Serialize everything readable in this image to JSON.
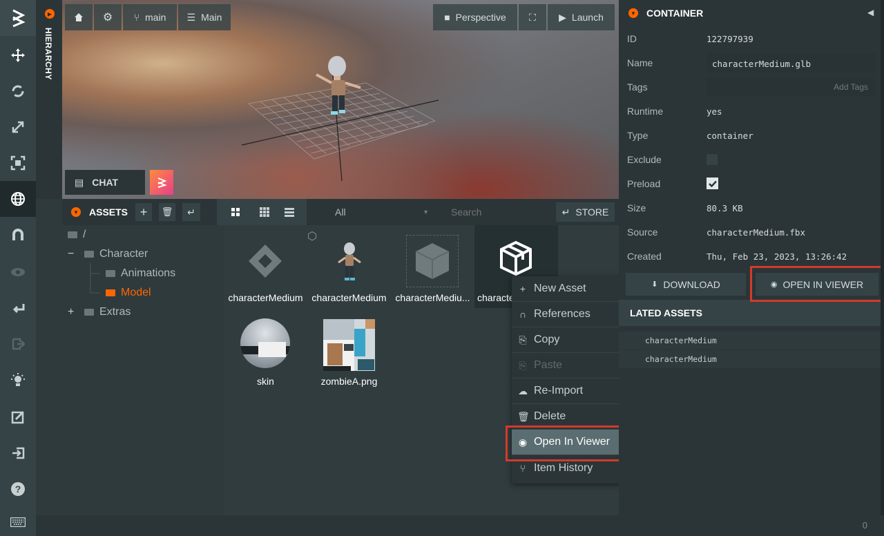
{
  "toolbar": {
    "logo": "logo-icon",
    "tools": [
      "move-icon",
      "rotate-icon",
      "scale-icon",
      "resize-icon",
      "world-icon",
      "magnet-icon",
      "eye-icon",
      "bake-icon",
      "export-icon",
      "light-icon",
      "edit-icon",
      "import-icon",
      "help-icon",
      "keyboard-icon"
    ]
  },
  "hierarchy": {
    "label": "HIERARCHY"
  },
  "viewport": {
    "home": "home-icon",
    "settings": "gear-icon",
    "branch": "main",
    "scene": "Main",
    "camera": "Perspective",
    "launch": "Launch",
    "chat": "CHAT"
  },
  "assets": {
    "title": "ASSETS",
    "filter": "All",
    "search_placeholder": "Search",
    "store": "STORE",
    "tree": {
      "root": "/",
      "character": "Character",
      "animations": "Animations",
      "model": "Model",
      "extras": "Extras"
    },
    "items": [
      {
        "label": "characterMedium"
      },
      {
        "label": "characterMedium"
      },
      {
        "label": "characterMediu..."
      },
      {
        "label": "characte"
      },
      {
        "label": "skin"
      },
      {
        "label": "zombieA.png"
      }
    ]
  },
  "context_menu": {
    "items": [
      {
        "label": "New Asset",
        "icon": "+"
      },
      {
        "label": "References",
        "icon": "∩"
      },
      {
        "label": "Copy",
        "icon": "⎘"
      },
      {
        "label": "Paste",
        "icon": "⎘"
      },
      {
        "label": "Re-Import",
        "icon": "☁"
      },
      {
        "label": "Delete",
        "icon": "🗑"
      },
      {
        "label": "Open In Viewer",
        "icon": "◉"
      },
      {
        "label": "Item History",
        "icon": "⑂"
      }
    ]
  },
  "inspector": {
    "title": "CONTAINER",
    "rows": {
      "id_label": "ID",
      "id": "122797939",
      "name_label": "Name",
      "name": "characterMedium.glb",
      "tags_label": "Tags",
      "tags_placeholder": "Add Tags",
      "runtime_label": "Runtime",
      "runtime": "yes",
      "type_label": "Type",
      "type": "container",
      "exclude_label": "Exclude",
      "preload_label": "Preload",
      "size_label": "Size",
      "size": "80.3 KB",
      "source_label": "Source",
      "source": "characterMedium.fbx",
      "created_label": "Created",
      "created": "Thu, Feb 23, 2023, 13:26:42"
    },
    "download": "DOWNLOAD",
    "open_in_viewer": "OPEN IN VIEWER",
    "related_title": "LATED ASSETS",
    "related": [
      "characterMedium",
      "characterMedium"
    ]
  },
  "statusbar": {
    "count": "0"
  },
  "colors": {
    "accent": "#ff6600",
    "highlight": "#d43a2a",
    "menu_hover": "#5a6d70"
  }
}
